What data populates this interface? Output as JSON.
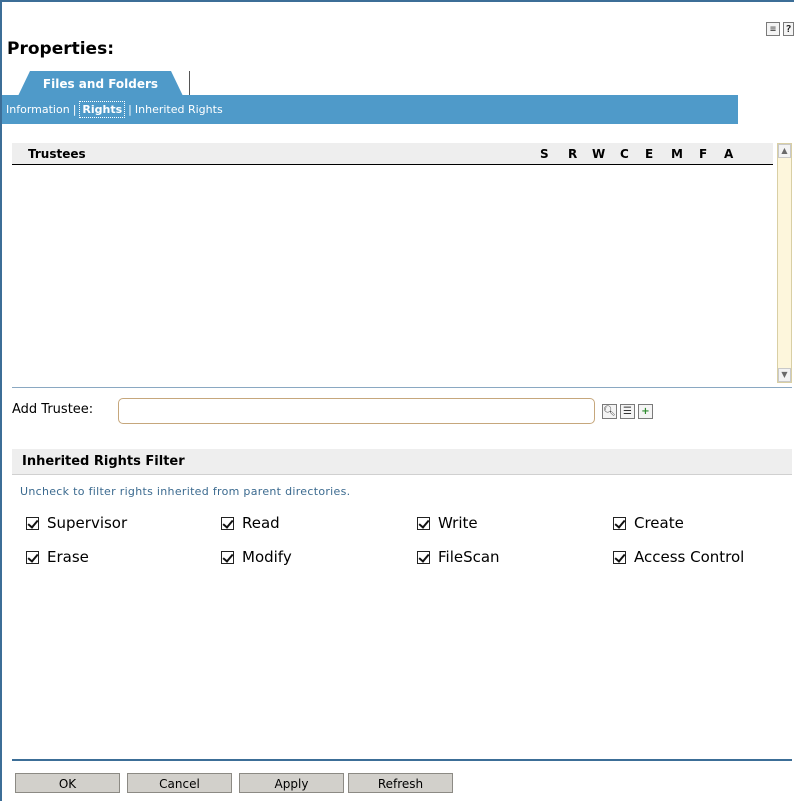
{
  "header": {
    "title": "Properties:",
    "icons": [
      "edit-list-icon",
      "help-icon"
    ],
    "help_glyph": "?"
  },
  "tabs": {
    "main_tab": "Files and Folders",
    "subnav": {
      "information": "Information",
      "rights": "Rights",
      "inherited_rights": "Inherited Rights",
      "separator": "|"
    }
  },
  "trustee_table": {
    "columns": [
      "Trustees",
      "S",
      "R",
      "W",
      "C",
      "E",
      "M",
      "F",
      "A"
    ],
    "rows": []
  },
  "add_trustee": {
    "label": "Add Trustee:",
    "value": "",
    "icons": [
      "search-icon",
      "browse-tree-icon",
      "add-icon"
    ]
  },
  "inherited_rights_filter": {
    "title": "Inherited Rights Filter",
    "hint": "Uncheck to filter rights inherited from parent directories.",
    "rights": [
      {
        "label": "Supervisor",
        "checked": true
      },
      {
        "label": "Read",
        "checked": true
      },
      {
        "label": "Write",
        "checked": true
      },
      {
        "label": "Create",
        "checked": true
      },
      {
        "label": "Erase",
        "checked": true
      },
      {
        "label": "Modify",
        "checked": true
      },
      {
        "label": "FileScan",
        "checked": true
      },
      {
        "label": "Access Control",
        "checked": true
      }
    ]
  },
  "buttons": {
    "ok": "OK",
    "cancel": "Cancel",
    "apply": "Apply",
    "refresh": "Refresh"
  },
  "colors": {
    "accent": "#4f9ac9",
    "frame": "#3c6e97",
    "input_border": "#c6a77c",
    "button_bg": "#d2d0cb"
  }
}
